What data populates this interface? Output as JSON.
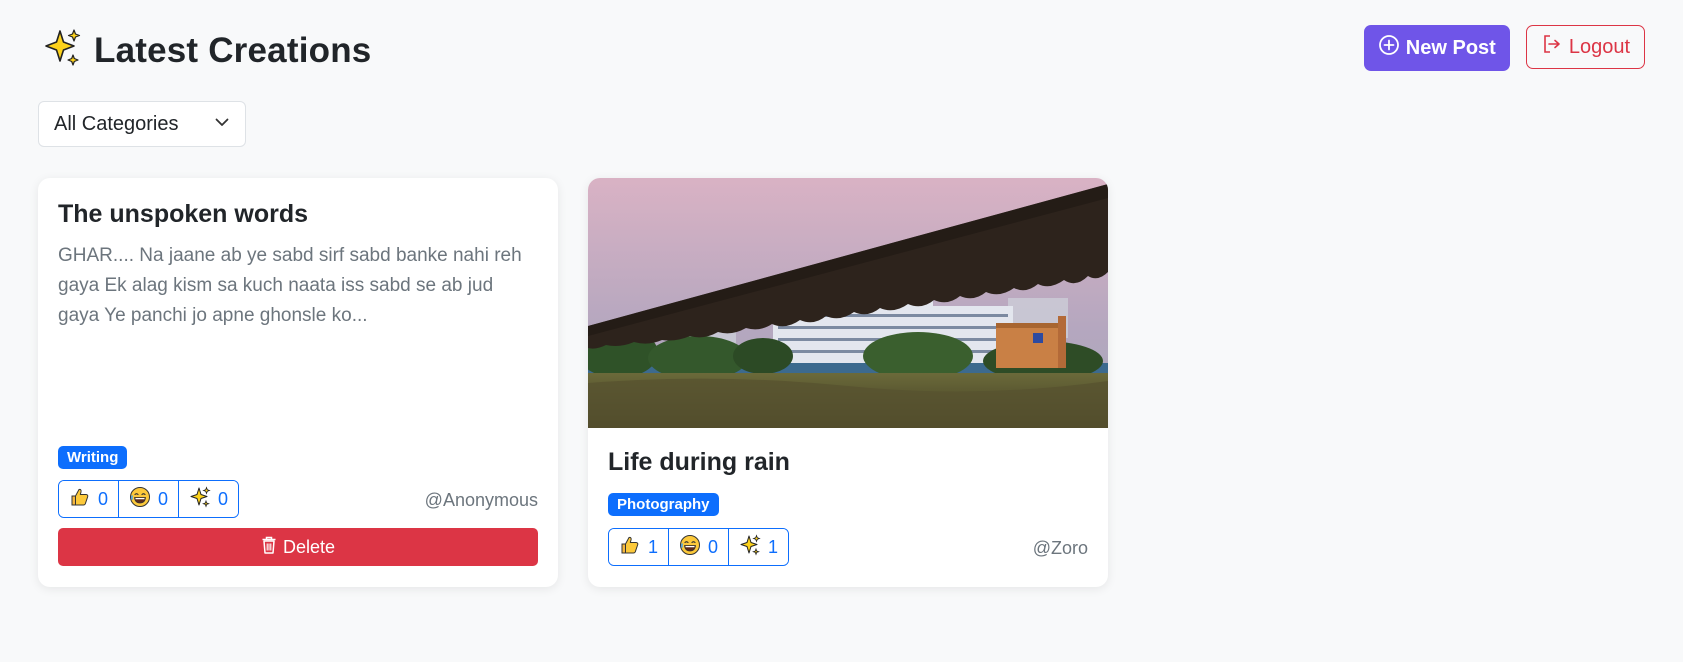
{
  "header": {
    "title": "Latest Creations",
    "new_post_label": "New Post",
    "logout_label": "Logout"
  },
  "filter": {
    "selected": "All Categories"
  },
  "posts": [
    {
      "title": "The unspoken words",
      "excerpt": "GHAR.... Na jaane ab ye sabd sirf sabd banke nahi reh gaya Ek alag kism sa kuch naata iss sabd se ab jud gaya Ye panchi jo apne ghonsle ko...",
      "category": "Writing",
      "likes": "0",
      "laughs": "0",
      "sparkles": "0",
      "author": "@Anonymous",
      "delete_label": "Delete"
    },
    {
      "title": "Life during rain",
      "category": "Photography",
      "likes": "1",
      "laughs": "0",
      "sparkles": "1",
      "author": "@Zoro"
    }
  ],
  "colors": {
    "primary": "#0d6efd",
    "accent": "#6f55e8",
    "danger": "#dc3545",
    "background": "#f8f9fa"
  },
  "icons": {
    "title": "sparkles-icon",
    "new_post": "plus-circle-icon",
    "logout": "logout-icon",
    "select": "chevron-down-icon",
    "like": "thumbs-up-icon",
    "laugh": "laughing-face-icon",
    "sparkle": "sparkles-icon",
    "delete": "trash-icon"
  }
}
